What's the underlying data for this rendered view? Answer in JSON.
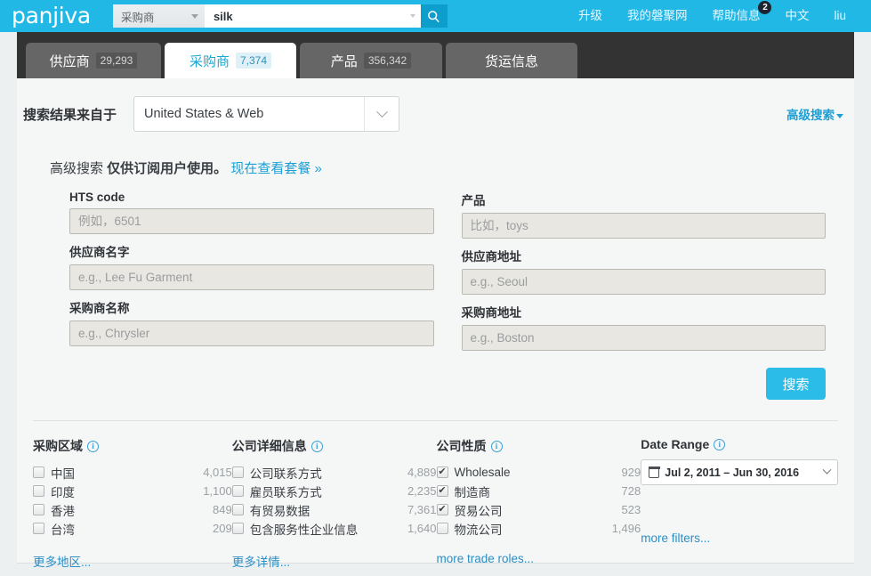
{
  "brand": {
    "logo": "panjiva"
  },
  "search": {
    "scope_label": "采购商",
    "query_value": "silk",
    "search_icon": "magnifier-icon"
  },
  "topnav": {
    "items": [
      {
        "label": "升级",
        "badge": null
      },
      {
        "label": "我的磐聚网",
        "badge": null
      },
      {
        "label": "帮助信息",
        "badge": "2"
      },
      {
        "label": "中文",
        "badge": null
      },
      {
        "label": "liu",
        "badge": null
      }
    ]
  },
  "tabs": [
    {
      "label": "供应商",
      "count": "29,293",
      "active": false
    },
    {
      "label": "采购商",
      "count": "7,374",
      "active": true
    },
    {
      "label": "产品",
      "count": "356,342",
      "active": false
    },
    {
      "label": "货运信息",
      "count": "",
      "active": false
    }
  ],
  "source_row": {
    "label": "搜索结果来自于",
    "country_value": "United States & Web",
    "advanced_link": "高级搜索"
  },
  "notice": {
    "prefix": "高级搜索 ",
    "bold": "仅供订阅用户使用。",
    "link": "现在查看套餐 »"
  },
  "form": {
    "left": [
      {
        "label": "HTS code",
        "value": "",
        "placeholder": "例如，6501",
        "name": "hts-code-field"
      },
      {
        "label": "供应商名字",
        "value": "",
        "placeholder": "e.g., Lee Fu Garment",
        "name": "supplier-name-field"
      },
      {
        "label": "采购商名称",
        "value": "",
        "placeholder": "e.g., Chrysler",
        "name": "buyer-name-field"
      }
    ],
    "right": [
      {
        "label": "产品",
        "value": "",
        "placeholder": "比如，toys",
        "name": "product-field"
      },
      {
        "label": "供应商地址",
        "value": "",
        "placeholder": "e.g., Seoul",
        "name": "supplier-address-field"
      },
      {
        "label": "采购商地址",
        "value": "",
        "placeholder": "e.g., Boston",
        "name": "buyer-address-field"
      }
    ],
    "submit_label": "搜索"
  },
  "filters": [
    {
      "title": "采购区域",
      "info_icon": "info-icon",
      "items": [
        {
          "label": "中国",
          "count": "4,015",
          "checked": false
        },
        {
          "label": "印度",
          "count": "1,100",
          "checked": false
        },
        {
          "label": "香港",
          "count": "849",
          "checked": false
        },
        {
          "label": "台湾",
          "count": "209",
          "checked": false
        }
      ],
      "more": "更多地区..."
    },
    {
      "title": "公司详细信息",
      "info_icon": "info-icon",
      "items": [
        {
          "label": "公司联系方式",
          "count": "4,889",
          "checked": false
        },
        {
          "label": "雇员联系方式",
          "count": "2,235",
          "checked": false
        },
        {
          "label": "有贸易数据",
          "count": "7,361",
          "checked": false
        },
        {
          "label": "包含服务性企业信息",
          "count": "1,640",
          "checked": false
        }
      ],
      "more": "更多详情..."
    },
    {
      "title": "公司性质",
      "info_icon": "info-icon",
      "items": [
        {
          "label": "Wholesale",
          "count": "929",
          "checked": true
        },
        {
          "label": "制造商",
          "count": "728",
          "checked": true
        },
        {
          "label": "贸易公司",
          "count": "523",
          "checked": true
        },
        {
          "label": "物流公司",
          "count": "1,496",
          "checked": false
        }
      ],
      "more": "more trade roles..."
    },
    {
      "title": "Date Range",
      "info_icon": "info-icon",
      "date_value": "Jul 2, 2011 – Jun 30, 2016",
      "calendar_icon": "calendar-icon",
      "more": "more filters..."
    }
  ],
  "colors": {
    "brand_cyan": "#22b8e6",
    "tab_dark": "#333333",
    "link_blue": "#1d9fd4",
    "button_cyan": "#2cbce8"
  }
}
